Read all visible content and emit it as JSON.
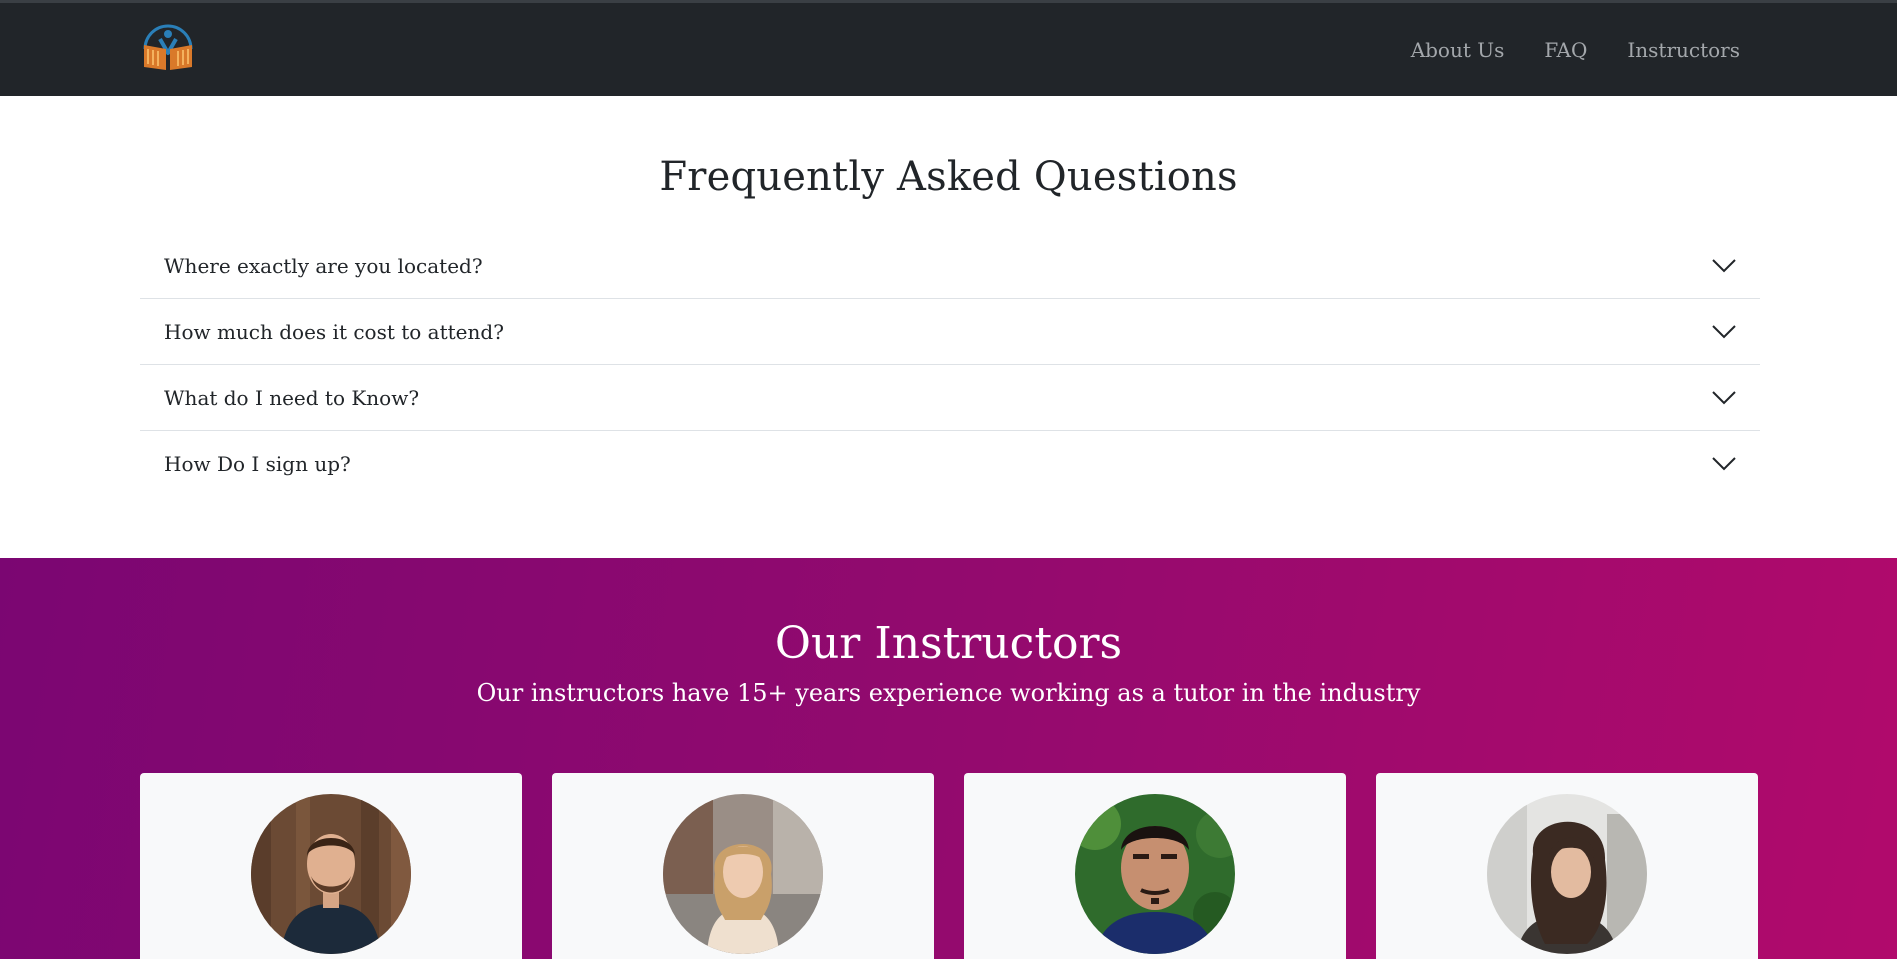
{
  "navbar": {
    "logo_icon": "open-book-person-logo",
    "links": [
      "About Us",
      "FAQ",
      "Instructors"
    ]
  },
  "faq": {
    "title": "Frequently Asked Questions",
    "items": [
      "Where exactly are you located?",
      "How much does it cost to attend?",
      "What do I need to Know?",
      "How Do I sign up?"
    ]
  },
  "instructors": {
    "title": "Our Instructors",
    "subtitle": "Our instructors have 15+ years experience working as a tutor in the industry",
    "cards": [
      {
        "avatar": "instructor-photo-1"
      },
      {
        "avatar": "instructor-photo-2"
      },
      {
        "avatar": "instructor-photo-3"
      },
      {
        "avatar": "instructor-photo-4"
      }
    ]
  },
  "colors": {
    "navbar_bg": "#212529",
    "nav_link": "#a3a7ab",
    "gradient_start": "#7b0672",
    "gradient_end": "#b10a6c",
    "card_bg": "#f8f9fa"
  }
}
